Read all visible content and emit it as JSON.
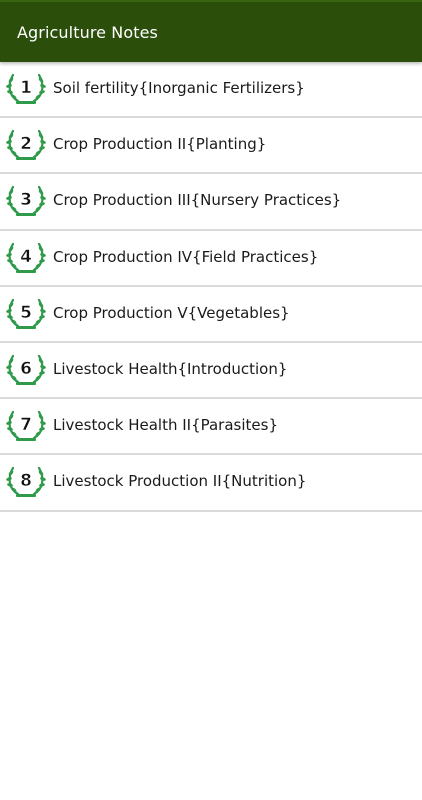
{
  "app_bar": {
    "title": "Agriculture Notes",
    "color": "#2c4e0b"
  },
  "list": {
    "items": [
      {
        "number": "1",
        "label": "Soil fertility{Inorganic Fertilizers}",
        "icon": "laurel-wreath-badge-icon"
      },
      {
        "number": "2",
        "label": "Crop Production II{Planting}",
        "icon": "laurel-wreath-badge-icon"
      },
      {
        "number": "3",
        "label": "Crop Production III{Nursery Practices}",
        "icon": "laurel-wreath-badge-icon"
      },
      {
        "number": "4",
        "label": "Crop Production IV{Field Practices}",
        "icon": "laurel-wreath-badge-icon"
      },
      {
        "number": "5",
        "label": "Crop Production V{Vegetables}",
        "icon": "laurel-wreath-badge-icon"
      },
      {
        "number": "6",
        "label": "Livestock Health{Introduction}",
        "icon": "laurel-wreath-badge-icon"
      },
      {
        "number": "7",
        "label": "Livestock Health II{Parasites}",
        "icon": "laurel-wreath-badge-icon"
      },
      {
        "number": "8",
        "label": "Livestock Production II{Nutrition}",
        "icon": "laurel-wreath-badge-icon"
      }
    ],
    "wreath_color": "#2e9a4a",
    "divider_color": "#d9d9d9"
  }
}
